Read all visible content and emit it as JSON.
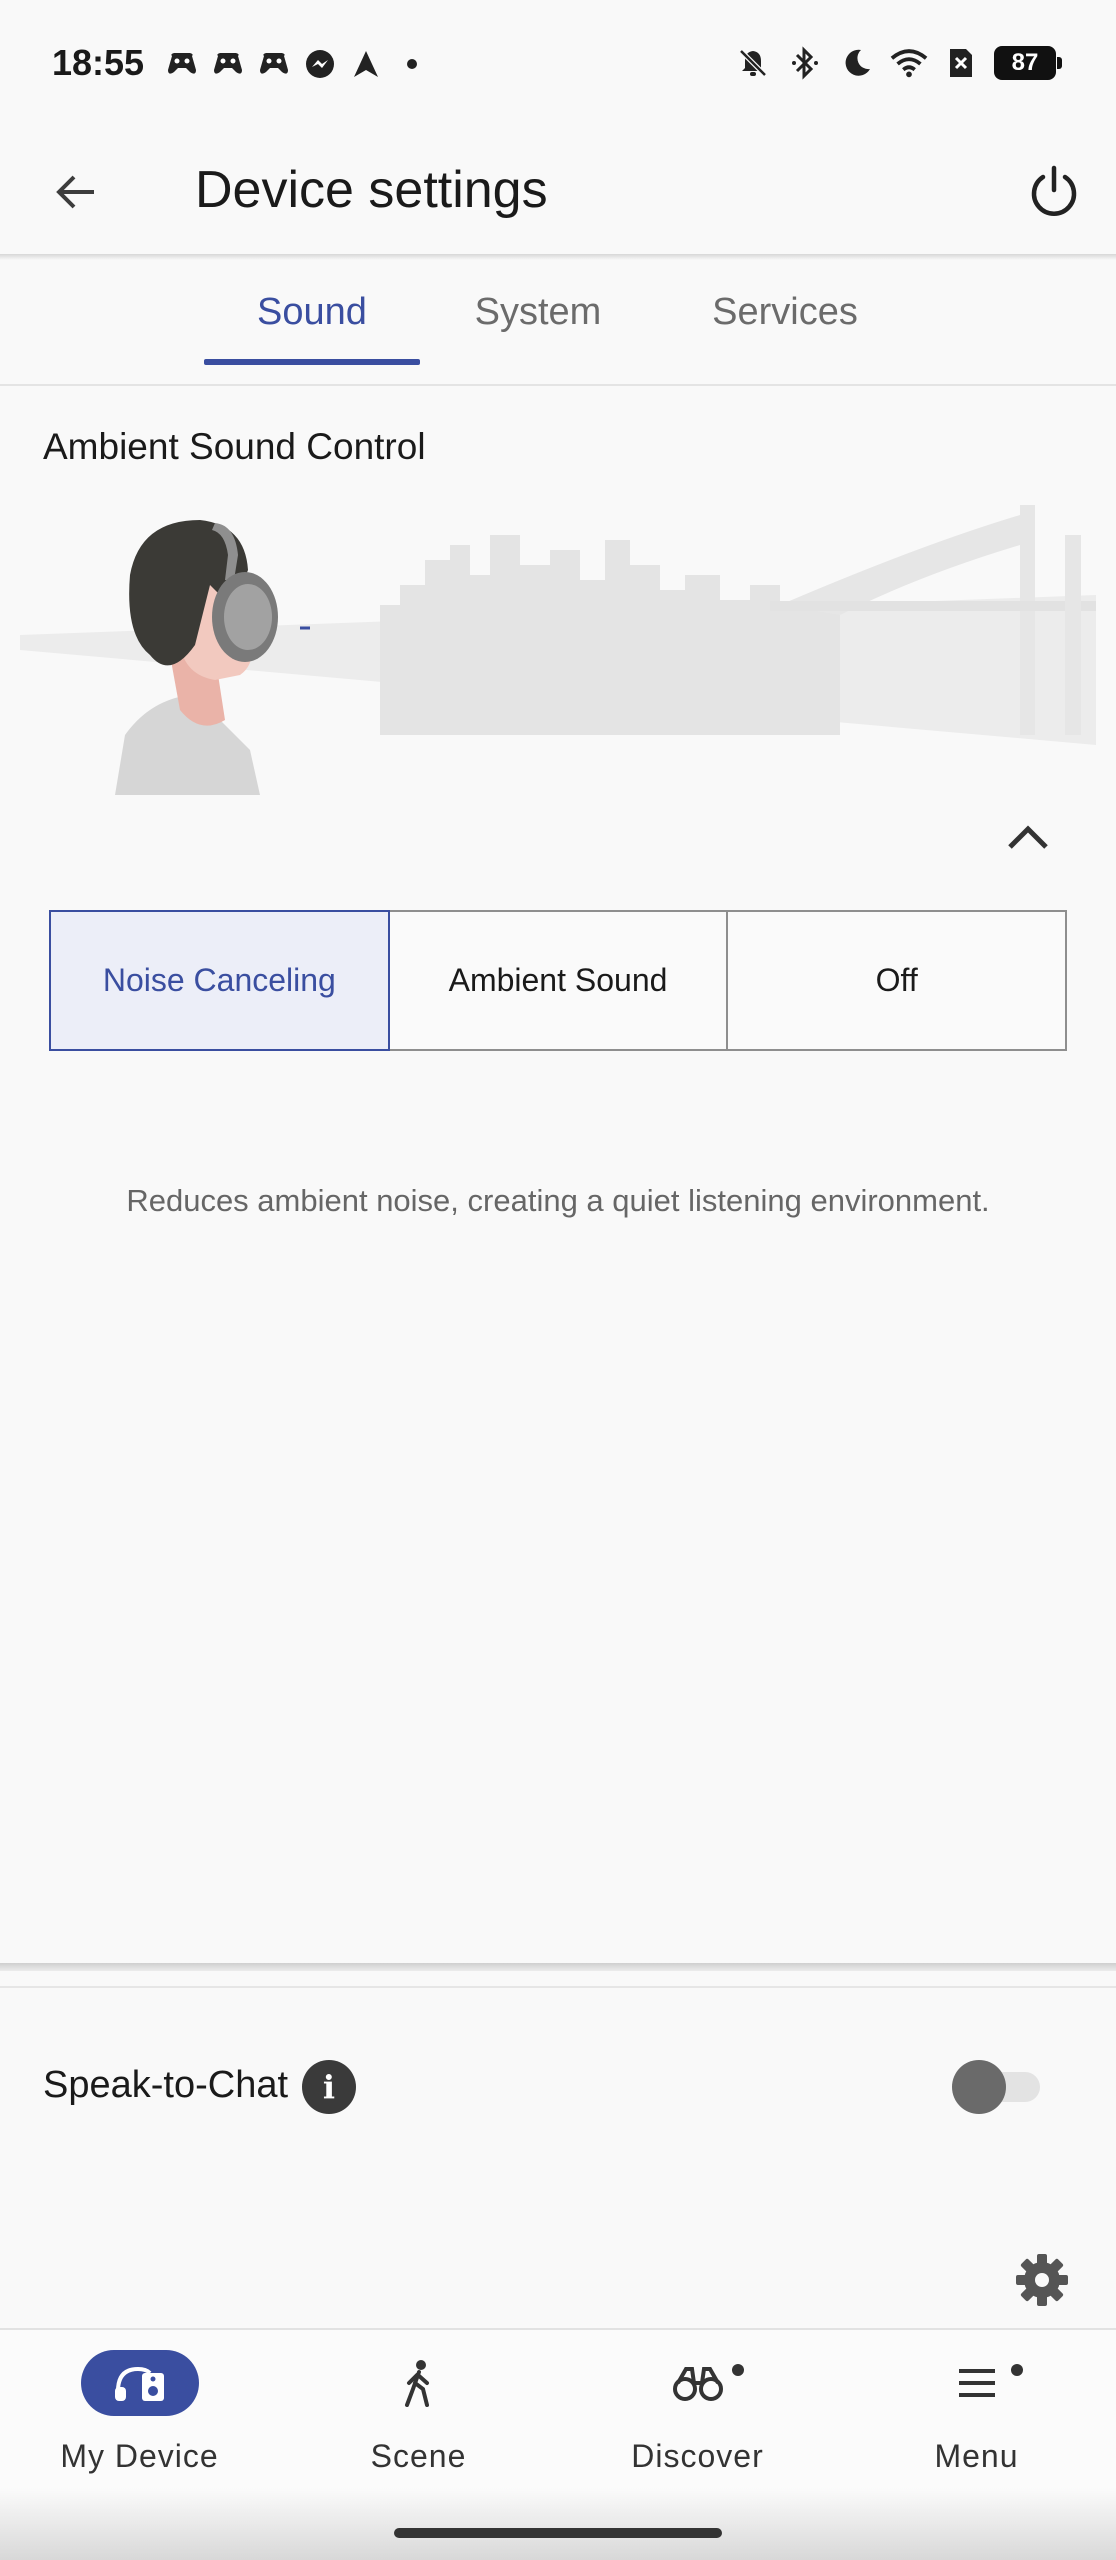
{
  "status_bar": {
    "time": "18:55",
    "notification_icons": [
      "game-controller-icon",
      "game-controller-icon",
      "game-controller-icon",
      "messenger-icon",
      "navigation-arrow-icon",
      "dot-icon"
    ],
    "system_icons": [
      "bell-off-icon",
      "bluetooth-icon",
      "moon-icon",
      "wifi-icon",
      "sim-x-icon"
    ],
    "battery": "87"
  },
  "app_bar": {
    "title": "Device settings",
    "back_icon": "arrow-left-icon",
    "power_icon": "power-icon"
  },
  "tabs": [
    {
      "label": "Sound",
      "active": true
    },
    {
      "label": "System",
      "active": false
    },
    {
      "label": "Services",
      "active": false
    }
  ],
  "ambient_sound_control": {
    "title": "Ambient Sound Control",
    "illustration": "person-with-headphones-city-skyline",
    "collapse_icon": "chevron-up-icon",
    "modes": [
      {
        "label": "Noise Canceling",
        "selected": true
      },
      {
        "label": "Ambient Sound",
        "selected": false
      },
      {
        "label": "Off",
        "selected": false
      }
    ],
    "description": "Reduces ambient noise, creating a quiet listening environment."
  },
  "speak_to_chat": {
    "label": "Speak-to-Chat",
    "info_icon": "info-icon",
    "enabled": false,
    "settings_icon": "gear-icon"
  },
  "bottom_nav": [
    {
      "label": "My Device",
      "icon": "headphones-device-icon",
      "active": true,
      "badge": false
    },
    {
      "label": "Scene",
      "icon": "walking-person-icon",
      "active": false,
      "badge": false
    },
    {
      "label": "Discover",
      "icon": "binoculars-icon",
      "active": false,
      "badge": true
    },
    {
      "label": "Menu",
      "icon": "menu-icon",
      "active": false,
      "badge": true
    }
  ],
  "colors": {
    "accent": "#3a4ea0",
    "background": "#f9f9f9",
    "selected_fill": "#eceef8"
  }
}
